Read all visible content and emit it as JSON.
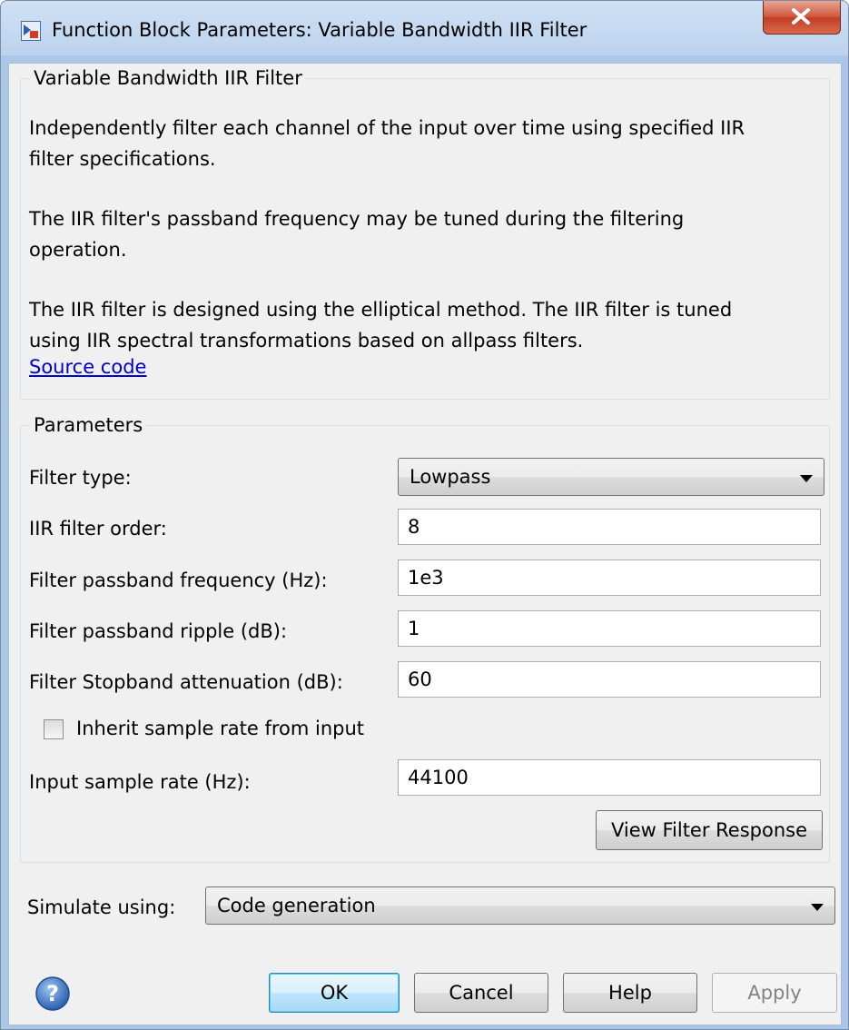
{
  "window": {
    "title": "Function Block Parameters: Variable Bandwidth IIR Filter"
  },
  "description": {
    "legend": "Variable Bandwidth IIR Filter",
    "para1_line1": "Independently filter each channel of the input over time using specified IIR",
    "para1_line2": "filter specifications.",
    "para2_line1": "The IIR filter's passband frequency may be tuned during the filtering",
    "para2_line2": "operation.",
    "para3_line1": "The IIR filter is designed using the elliptical method. The IIR filter is tuned",
    "para3_line2": "using IIR spectral transformations based on allpass filters.",
    "link": "Source code"
  },
  "parameters": {
    "legend": "Parameters",
    "filter_type": {
      "label": "Filter type:",
      "value": "Lowpass"
    },
    "filter_order": {
      "label": "IIR filter order:",
      "value": "8"
    },
    "passband_freq": {
      "label": "Filter passband frequency (Hz):",
      "value": "1e3"
    },
    "passband_ripple": {
      "label": "Filter passband ripple (dB):",
      "value": "1"
    },
    "stopband_atten": {
      "label": "Filter Stopband attenuation (dB):",
      "value": "60"
    },
    "inherit": {
      "label": "Inherit sample rate from input",
      "checked": false
    },
    "sample_rate": {
      "label": "Input sample rate (Hz):",
      "value": "44100"
    },
    "view_response": "View Filter Response"
  },
  "simulate": {
    "label": "Simulate using:",
    "value": "Code generation"
  },
  "buttons": {
    "ok": "OK",
    "cancel": "Cancel",
    "help": "Help",
    "apply": "Apply"
  },
  "colors": {
    "link": "#0000cc",
    "close": "#c23d24",
    "accent": "#3c7fb1"
  }
}
